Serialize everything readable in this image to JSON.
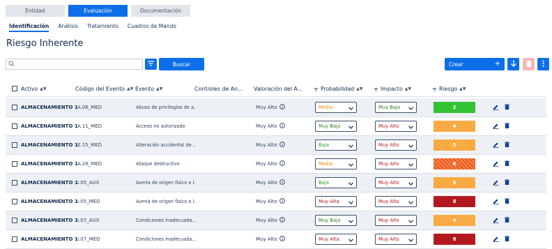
{
  "top_tabs": [
    "Entidad",
    "Evaluación",
    "Documentación"
  ],
  "active_top_tab": 1,
  "sub_tabs": [
    "Identificación",
    "Análisis",
    "Tratamiento",
    "Cuadros de Mando"
  ],
  "active_sub_tab": 0,
  "page_title": "Riesgo Inherente",
  "search": {
    "value": "",
    "placeholder": ""
  },
  "buttons": {
    "buscar": "Buscar",
    "crear": "Crear"
  },
  "columns": {
    "activo": "Activo",
    "codigo": "Código del Evento",
    "evento": "Evento",
    "controles": "Controles de An...",
    "valoracion": "Valoración del A...",
    "probabilidad": "Probabilidad",
    "impacto": "Impacto",
    "riesgo": "Riesgo"
  },
  "level_colors": {
    "Muy Baja": "#2e7d1e",
    "Baja": "#2e9e1e",
    "Media": "#f08c00",
    "Muy Alta": "#b4181f",
    "Muy Bajo": "#2e7d1e",
    "Muy Alto": "#b4181f"
  },
  "rows": [
    {
      "activo": "ALMACENAMIENTO 1",
      "codigo": "A.06_MED",
      "evento": "Abuso de privilegios de a...",
      "valoracion": "Muy Alto",
      "probabilidad": "Media",
      "impacto": "Muy Bajo",
      "riesgo": "2",
      "riesgo_style": "green"
    },
    {
      "activo": "ALMACENAMIENTO 1",
      "codigo": "A.11_MED",
      "evento": "Acceso no autorizado",
      "valoracion": "Muy Alto",
      "probabilidad": "Muy Baja",
      "impacto": "Muy Alto",
      "riesgo": "4",
      "riesgo_style": "orange"
    },
    {
      "activo": "ALMACENAMIENTO 1",
      "codigo": "E.15_MED",
      "evento": "Alteración accidental de ...",
      "valoracion": "Muy Alto",
      "probabilidad": "Baja",
      "impacto": "Muy Alto",
      "riesgo": "5",
      "riesgo_style": "orange"
    },
    {
      "activo": "ALMACENAMIENTO 1",
      "codigo": "A.26_MED",
      "evento": "Ataque destructivo",
      "valoracion": "Muy Alto",
      "probabilidad": "Media",
      "impacto": "Muy Alto",
      "riesgo": "6",
      "riesgo_style": "darkorange"
    },
    {
      "activo": "ALMACENAMIENTO 1",
      "codigo": "I.05_AUX",
      "evento": "Avería de origen físico o l...",
      "valoracion": "Muy Alto",
      "probabilidad": "Baja",
      "impacto": "Muy Alto",
      "riesgo": "5",
      "riesgo_style": "orange"
    },
    {
      "activo": "ALMACENAMIENTO 1",
      "codigo": "I.05_MED",
      "evento": "Avería de origen físico o l...",
      "valoracion": "Muy Alto",
      "probabilidad": "Muy Alta",
      "impacto": "Muy Alto",
      "riesgo": "8",
      "riesgo_style": "red"
    },
    {
      "activo": "ALMACENAMIENTO 1",
      "codigo": "I.07_AUX",
      "evento": "Condiciones inadecuada...",
      "valoracion": "Muy Alto",
      "probabilidad": "Muy Baja",
      "impacto": "Muy Alto",
      "riesgo": "4",
      "riesgo_style": "orange"
    },
    {
      "activo": "ALMACENAMIENTO 1",
      "codigo": "I.07_MED",
      "evento": "Condiciones inadecuada...",
      "valoracion": "Muy Alto",
      "probabilidad": "Muy Alta",
      "impacto": "Muy Alto",
      "riesgo": "8",
      "riesgo_style": "red"
    }
  ]
}
